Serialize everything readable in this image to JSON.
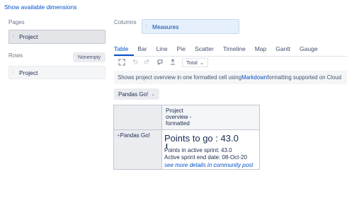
{
  "header": {
    "show_dimensions_link": "Show available dimensions"
  },
  "pages": {
    "label": "Pages",
    "items": [
      {
        "label": "Project"
      }
    ]
  },
  "rows": {
    "label": "Rows",
    "nonempty_button": "Nonempty",
    "items": [
      {
        "label": "Project"
      }
    ]
  },
  "columns": {
    "label": "Columns",
    "items": [
      {
        "label": "Measures"
      }
    ]
  },
  "tabs": [
    {
      "label": "Table",
      "active": true
    },
    {
      "label": "Bar"
    },
    {
      "label": "Line"
    },
    {
      "label": "Pie"
    },
    {
      "label": "Scatter"
    },
    {
      "label": "Timeline"
    },
    {
      "label": "Map"
    },
    {
      "label": "Gantt"
    },
    {
      "label": "Gauge"
    }
  ],
  "toolbar": {
    "icons": [
      "expand-icon",
      "undo-icon",
      "redo-icon",
      "comment-icon",
      "export-icon"
    ],
    "total_dropdown": "Total"
  },
  "info_bar": {
    "text_before": "Shows project overview in one formatted cell using ",
    "link": "Markdown",
    "text_after": " formatting supported on Cloud"
  },
  "page_selector": {
    "value": "Pandas Go!"
  },
  "table": {
    "column_header": [
      "Project",
      "overview -",
      "formatted"
    ],
    "row_header": "Pandas Go!",
    "cell": {
      "title": "Points to go : 43.0",
      "line1": "Points in active sprint: 43.0",
      "line2": "Active sprint end date: 08-Oct-20",
      "link": "see more details in community post"
    }
  },
  "colors": {
    "accent": "#0052cc",
    "panel": "#ebecf0",
    "columns_chip": "#e6effc"
  }
}
